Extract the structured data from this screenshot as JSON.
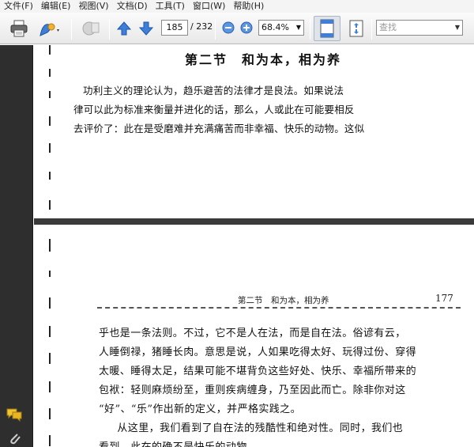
{
  "menu": {
    "items": [
      "文件(F)",
      "编辑(E)",
      "视图(V)",
      "文档(D)",
      "工具(T)",
      "窗口(W)",
      "帮助(H)"
    ]
  },
  "toolbar": {
    "current_page": "185",
    "total_pages": "/ 232",
    "zoom": "68.4%",
    "find_placeholder": "查找"
  },
  "page1": {
    "chapter_title": "第二节　和为本，相为养",
    "lines": [
      "功利主义的理论认为，趋乐避苦的法律才是良法。如果说法",
      "律可以此为标准来衡量并进化的话，那么，人或此在可能要相反",
      "去评价了：此在是受磨难并充满痛苦而非幸福、快乐的动物。这似"
    ]
  },
  "page2": {
    "running_head": "第二节　和为本，相为养",
    "page_number": "177",
    "lines": [
      "乎也是一条法则。不过，它不是人在法，而是自在法。俗谚有云，",
      "人睡倒禄，猪睡长肉。意思是说，人如果吃得太好、玩得过份、穿得",
      "太暖、睡得太足，结果可能不堪背负这些好处、快乐、幸福所带来的",
      "包袱：轻则麻烦纷至，重则疾病缠身，乃至因此而亡。除非你对这",
      "“好”、“乐”作出新的定义，并严格实践之。",
      "　从这里，我们看到了自在法的残酷性和绝对性。同时，我们也",
      "看到，此在的确不是快乐的动物。"
    ]
  },
  "icons": [
    "print-icon",
    "sign-icon",
    "collaborate-icon",
    "prev-page-icon",
    "next-page-icon",
    "zoom-out-icon",
    "zoom-in-icon",
    "fit-width-icon",
    "full-screen-icon",
    "comments-icon",
    "attachments-icon"
  ]
}
